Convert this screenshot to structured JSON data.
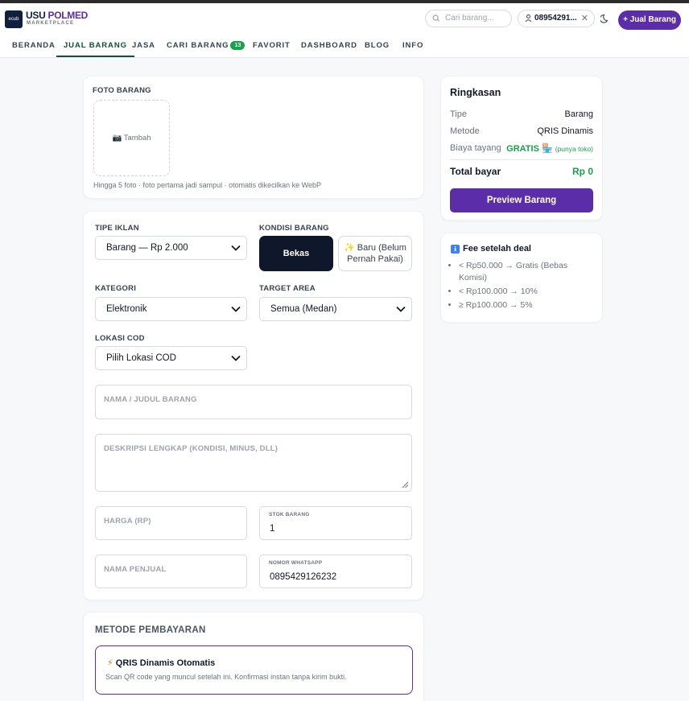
{
  "header": {
    "logo_mark": "ecub",
    "logo_title_1": "USU",
    "logo_title_2": "POLMED",
    "logo_subtitle": "MARKETPLACE",
    "search_placeholder": "Cari barang...",
    "phone_chip": "08954291...",
    "sell_button": "+ Jual Barang",
    "icons": [
      "search-icon",
      "user-icon",
      "close-icon",
      "moon-icon"
    ]
  },
  "nav": {
    "items": [
      {
        "label": "BERANDA"
      },
      {
        "label": "JUAL BARANG",
        "active": true
      },
      {
        "label": "JASA"
      },
      {
        "label": "CARI BARANG",
        "badge": "13"
      },
      {
        "label": "FAVORIT"
      },
      {
        "label": "DASHBOARD"
      },
      {
        "label": "BLOG"
      },
      {
        "label": "INFO"
      }
    ]
  },
  "photo": {
    "label": "FOTO BARANG",
    "add_label": "📷 Tambah",
    "hint": "Hingga 5 foto · foto pertama jadi sampul · otomatis dikecilkan ke WebP"
  },
  "form": {
    "tipe_iklan": {
      "label": "TIPE IKLAN",
      "value": "Barang — Rp 2.000"
    },
    "kondisi": {
      "label": "KONDISI BARANG",
      "selected": "Bekas",
      "other": "✨ Baru (Belum Pernah Pakai)"
    },
    "kategori": {
      "label": "KATEGORI",
      "value": "Elektronik"
    },
    "target_area": {
      "label": "TARGET AREA",
      "value": "Semua (Medan)"
    },
    "lokasi_cod": {
      "label": "LOKASI COD",
      "value": "Pilih Lokasi COD"
    },
    "judul": {
      "placeholder": "NAMA / JUDUL BARANG"
    },
    "deskripsi": {
      "placeholder": "DESKRIPSI LENGKAP (KONDISI, MINUS, DLL)"
    },
    "harga": {
      "placeholder": "HARGA (RP)"
    },
    "stok": {
      "label": "STOK BARANG",
      "value": "1"
    },
    "penjual": {
      "placeholder": "NAMA PENJUAL"
    },
    "whatsapp": {
      "label": "NOMOR WHATSAPP",
      "value": "0895429126232"
    }
  },
  "payment": {
    "title": "METODE PEMBAYARAN",
    "option_icon": "⚡",
    "option_title": "QRIS Dinamis Otomatis",
    "option_desc": "Scan QR code yang muncul setelah ini. Konfirmasi instan tanpa kirim bukti."
  },
  "summary": {
    "title": "Ringkasan",
    "rows": [
      {
        "label": "Tipe",
        "value": "Barang"
      },
      {
        "label": "Metode",
        "value": "QRIS Dinamis"
      }
    ],
    "fee_label": "Biaya tayang",
    "fee_value": "GRATIS",
    "fee_icon": "🏪",
    "fee_note": "(punya toko)",
    "total_label": "Total bayar",
    "total_value": "Rp 0",
    "preview_button": "Preview Barang"
  },
  "fee_info": {
    "icon": "ℹ",
    "title": "Fee setelah deal",
    "items": [
      "< Rp50.000 → Gratis (Bebas Komisi)",
      "< Rp100.000 → 10%",
      "≥ Rp100.000 → 5%"
    ]
  },
  "colors": {
    "brand": "#5b2da8",
    "accent_green": "#16a34a",
    "nav_active": "#0f5132",
    "dark": "#0f172a"
  }
}
